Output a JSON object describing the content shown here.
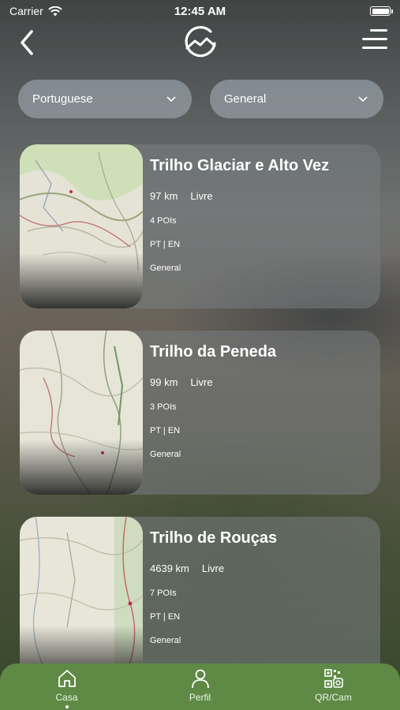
{
  "status_bar": {
    "carrier": "Carrier",
    "time": "12:45 AM"
  },
  "header": {
    "logo_icon": "g-mountain-logo-icon"
  },
  "filters": {
    "language": "Portuguese",
    "category": "General"
  },
  "trails": [
    {
      "title": "Trilho Glaciar e Alto Vez",
      "distance": "97 km",
      "access": "Livre",
      "pois": "4 POIs",
      "languages": "PT | EN",
      "type": "General"
    },
    {
      "title": "Trilho da Peneda",
      "distance": "99 km",
      "access": "Livre",
      "pois": "3 POIs",
      "languages": "PT | EN",
      "type": "General"
    },
    {
      "title": "Trilho de Rouças",
      "distance": "4639 km",
      "access": "Livre",
      "pois": "7 POIs",
      "languages": "PT | EN",
      "type": "General"
    }
  ],
  "bottom_nav": [
    {
      "label": "Casa",
      "icon": "home-icon"
    },
    {
      "label": "Perfil",
      "icon": "user-icon"
    },
    {
      "label": "QR/Cam",
      "icon": "qr-camera-icon"
    }
  ],
  "colors": {
    "nav_green": "#5e8a45"
  }
}
